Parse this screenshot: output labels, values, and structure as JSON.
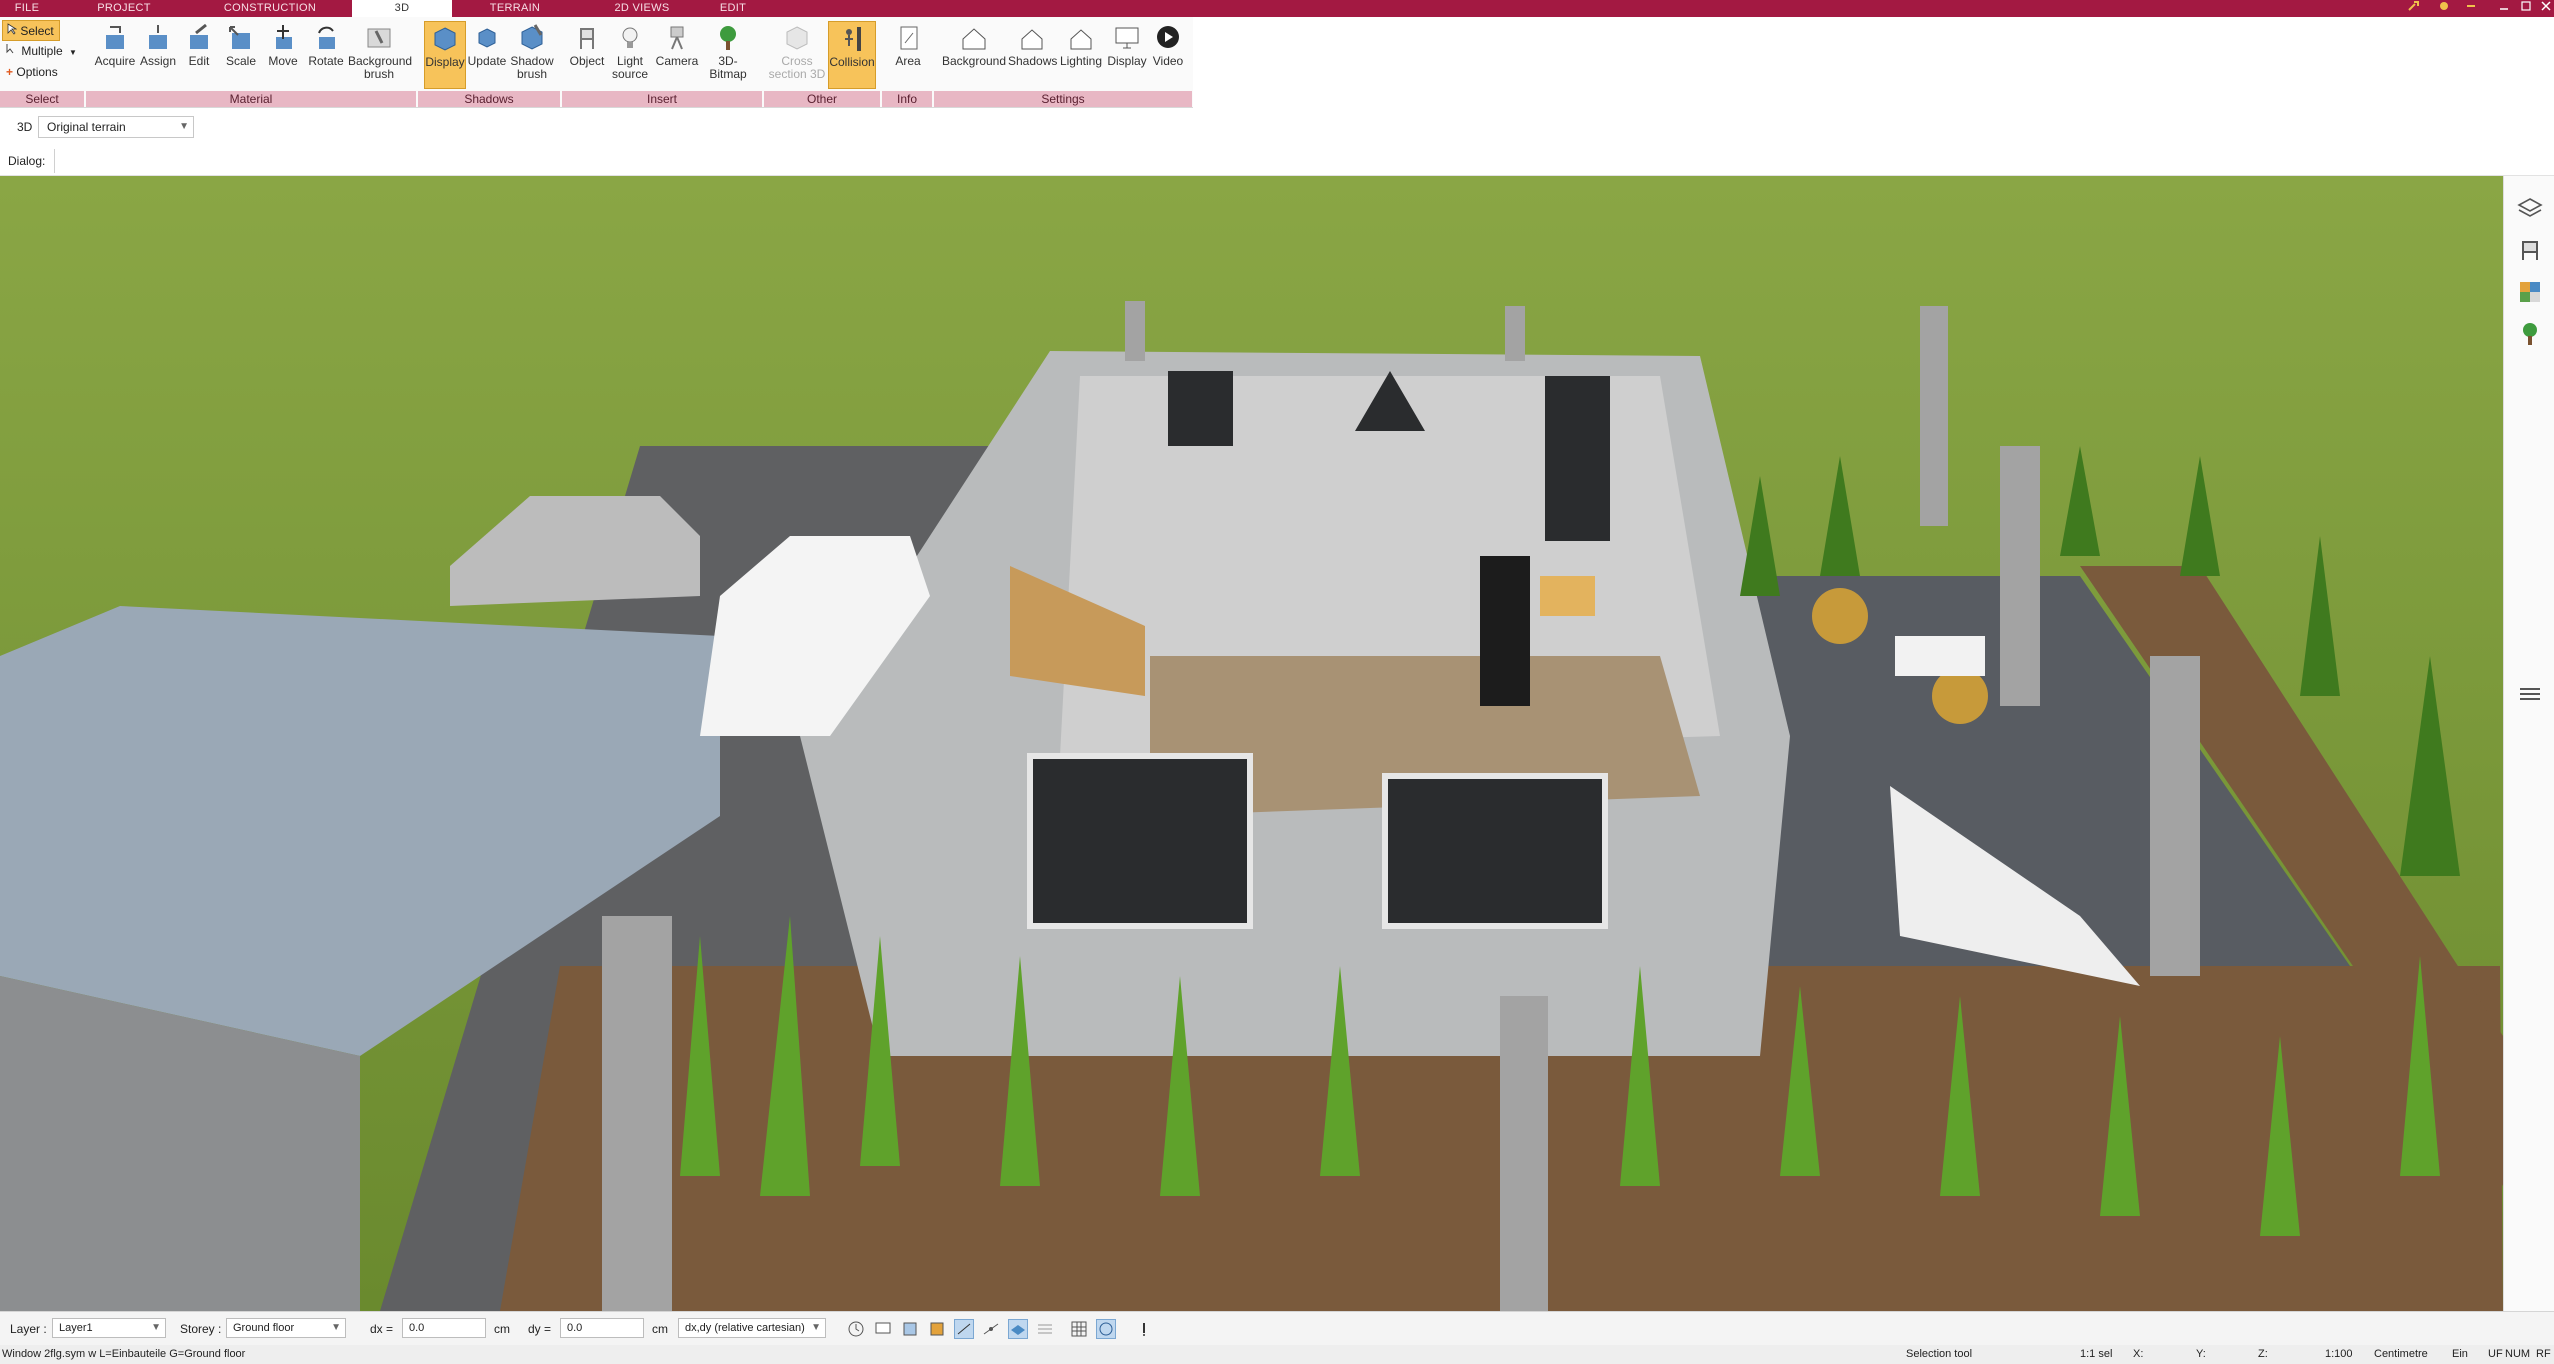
{
  "tabs": [
    "FILE",
    "PROJECT",
    "CONSTRUCTION",
    "3D",
    "TERRAIN",
    "2D VIEWS",
    "EDIT"
  ],
  "active_tab": "3D",
  "select_group": {
    "select": "Select",
    "multiple": "Multiple",
    "options": "Options"
  },
  "ribbon": {
    "acquire": "Acquire",
    "assign": "Assign",
    "edit": "Edit",
    "scale": "Scale",
    "move": "Move",
    "rotate": "Rotate",
    "background_brush": "Background brush",
    "display": "Display",
    "update": "Update",
    "shadow_brush": "Shadow brush",
    "object": "Object",
    "light_source": "Light source",
    "camera": "Camera",
    "bitmap3d": "3D-Bitmap",
    "cross_section": "Cross section 3D",
    "collision": "Collision",
    "area": "Area",
    "background": "Background",
    "shadows": "Shadows",
    "lighting": "Lighting",
    "display2": "Display",
    "video": "Video"
  },
  "groups": {
    "select": "Select",
    "material": "Material",
    "shadows": "Shadows",
    "insert": "Insert",
    "other": "Other",
    "info": "Info",
    "settings": "Settings"
  },
  "view": {
    "mode": "3D",
    "terrain": "Original terrain",
    "dialog_label": "Dialog:"
  },
  "status": {
    "layer_label": "Layer :",
    "layer_value": "Layer1",
    "storey_label": "Storey :",
    "storey_value": "Ground floor",
    "dx_label": "dx =",
    "dx_value": "0.0",
    "dx_unit": "cm",
    "dy_label": "dy =",
    "dy_value": "0.0",
    "dy_unit": "cm",
    "coord_mode": "dx,dy (relative cartesian)"
  },
  "bottom": {
    "hint": "Window 2flg.sym w L=Einbauteile G=Ground floor",
    "tool": "Selection tool",
    "sel": "1:1 sel",
    "x": "X:",
    "y": "Y:",
    "z": "Z:",
    "scale": "1:100",
    "unit": "Centimetre",
    "ein": "Ein",
    "uf": "UF",
    "num": "NUM",
    "rf": "RF"
  },
  "colors": {
    "accent": "#a31942",
    "group_label": "#e8b7c4",
    "active_button": "#f7c35a",
    "grass": "#7e9a3a"
  }
}
